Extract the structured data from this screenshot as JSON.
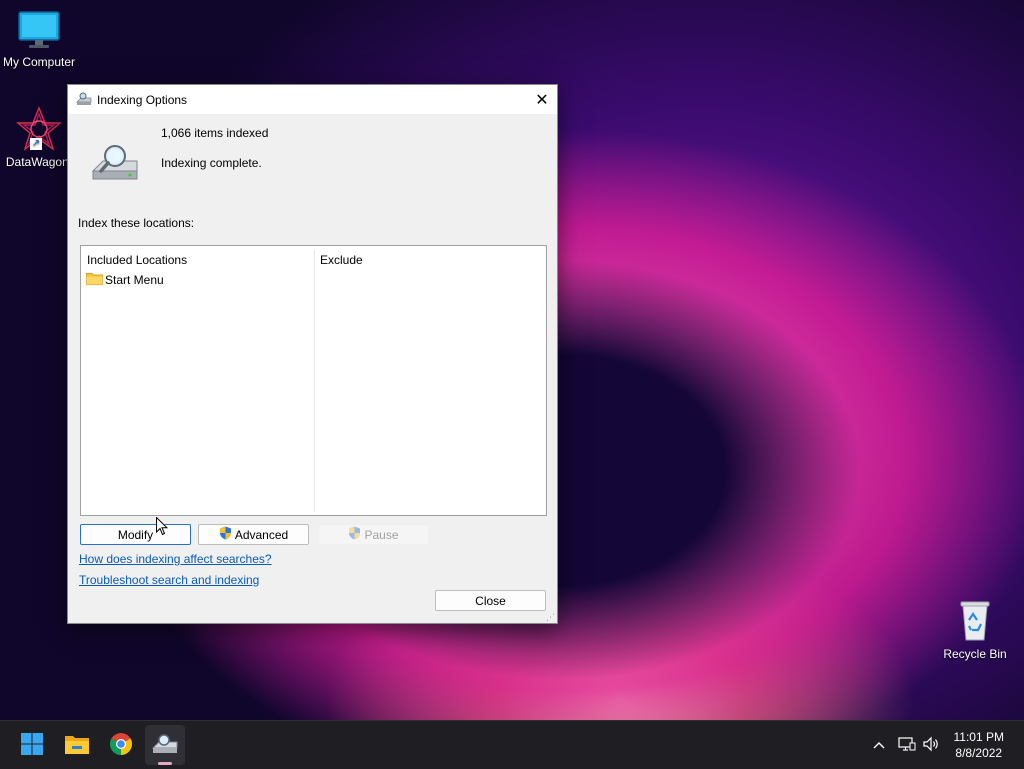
{
  "desktop": {
    "icons": [
      {
        "label": "My Computer",
        "icon": "monitor-icon"
      },
      {
        "label": "DataWagon.",
        "icon": "datawagon-app-icon"
      },
      {
        "label": "Recycle Bin",
        "icon": "recycle-bin-icon"
      }
    ]
  },
  "dialog": {
    "title": "Indexing Options",
    "items_indexed": "1,066 items indexed",
    "status": "Indexing complete.",
    "locations_label": "Index these locations:",
    "columns": [
      "Included Locations",
      "Exclude"
    ],
    "locations": [
      {
        "name": "Start Menu",
        "exclude": ""
      }
    ],
    "buttons": {
      "modify": "Modify",
      "advanced": "Advanced",
      "pause": "Pause",
      "close": "Close"
    },
    "links": {
      "how": "How does indexing affect searches?",
      "troubleshoot": "Troubleshoot search and indexing"
    }
  },
  "taskbar": {
    "pinned": [
      "start-icon",
      "file-explorer-icon",
      "chrome-icon",
      "indexing-options-icon"
    ],
    "tray": [
      "chevron-up-icon",
      "network-icon",
      "volume-icon"
    ],
    "time": "11:01 PM",
    "date": "8/8/2022"
  },
  "colors": {
    "accent": "#0a5bb5",
    "focus_border": "#2b6ecb",
    "taskbar": "#1f1f23"
  }
}
